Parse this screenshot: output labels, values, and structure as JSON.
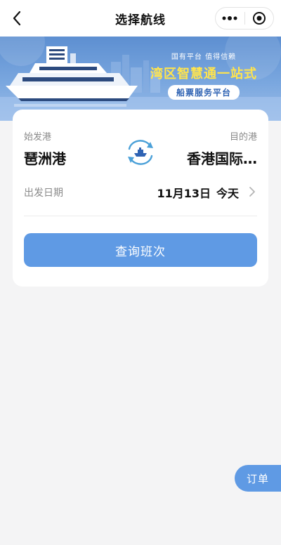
{
  "nav": {
    "title": "选择航线",
    "back_icon": "back-arrow-icon",
    "more_icon": "more-dots-icon",
    "close_icon": "target-close-icon"
  },
  "banner": {
    "subtitle": "国有平台 值得信赖",
    "headline": "湾区智慧通一站式",
    "pill": "船票服务平台",
    "colors": {
      "headline": "#ffe44d",
      "sky": "#5d8fd1"
    }
  },
  "route": {
    "from_label": "始发港",
    "from_port": "琶洲港",
    "to_label": "目的港",
    "to_port": "香港国际…",
    "swap_icon": "swap-ship-icon"
  },
  "date": {
    "label": "出发日期",
    "value": "11月13日",
    "day_hint": "今天",
    "chevron_icon": "chevron-right-icon"
  },
  "search_button": "查询班次",
  "orders_button": "订单",
  "colors": {
    "accent": "#5f9ae4",
    "background": "#f4f4f5"
  }
}
